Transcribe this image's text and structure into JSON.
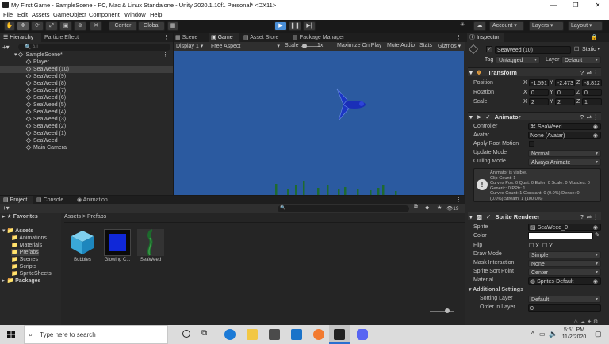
{
  "window": {
    "title": "My First Game - SampleScene - PC, Mac & Linux Standalone - Unity 2020.1.10f1 Personal* <DX11>",
    "min": "—",
    "max": "❐",
    "close": "✕"
  },
  "menu": [
    "File",
    "Edit",
    "Assets",
    "GameObject",
    "Component",
    "Window",
    "Help"
  ],
  "toolbar": {
    "center": "Center",
    "global": "Global",
    "account": "Account",
    "layers": "Layers",
    "layout": "Layout"
  },
  "hierarchy": {
    "tabs": [
      "Hierarchy",
      "Particle Effect"
    ],
    "search_placeholder": "All",
    "scene": "SampleScene*",
    "items": [
      "Player",
      "SeaWeed (10)",
      "SeaWeed (9)",
      "SeaWeed (8)",
      "SeaWeed (7)",
      "SeaWeed (6)",
      "SeaWeed (5)",
      "SeaWeed (4)",
      "SeaWeed (3)",
      "SeaWeed (2)",
      "SeaWeed (1)",
      "SeaWeed",
      "Main Camera"
    ],
    "selected_index": 1
  },
  "game": {
    "tabs": [
      "Scene",
      "Game",
      "Asset Store",
      "Package Manager"
    ],
    "display": "Display 1",
    "aspect": "Free Aspect",
    "scale_label": "Scale",
    "scale_value": "1x",
    "opts": [
      "Maximize On Play",
      "Mute Audio",
      "Stats",
      "Gizmos"
    ],
    "bg": "#2b5aa0"
  },
  "project": {
    "tabs": [
      "Project",
      "Console",
      "Animation"
    ],
    "favorites": "Favorites",
    "assets": "Assets",
    "folders": [
      "Animations",
      "Materials",
      "Prefabs",
      "Scenes",
      "Scripts",
      "SpriteSheets"
    ],
    "packages": "Packages",
    "breadcrumb_root": "Assets",
    "breadcrumb_sep": ">",
    "breadcrumb_leaf": "Prefabs",
    "count": "19",
    "items": [
      "Bubbles",
      "Glowing C...",
      "SeaWeed"
    ]
  },
  "inspector": {
    "tab": "Inspector",
    "name": "SeaWeed (10)",
    "static": "Static",
    "tag_label": "Tag",
    "tag": "Untagged",
    "layer_label": "Layer",
    "layer": "Default",
    "transform": {
      "title": "Transform",
      "position": "Position",
      "rotation": "Rotation",
      "scale": "Scale",
      "px": "-1.591",
      "py": "-2.473",
      "pz": "-8.812",
      "rx": "0",
      "ry": "0",
      "rz": "0",
      "sx": "2",
      "sy": "2",
      "sz": "1",
      "X": "X",
      "Y": "Y",
      "Z": "Z"
    },
    "animator": {
      "title": "Animator",
      "controller_label": "Controller",
      "controller": "SeaWeed",
      "avatar_label": "Avatar",
      "avatar": "None (Avatar)",
      "root_label": "Apply Root Motion",
      "update_label": "Update Mode",
      "update": "Normal",
      "culling_label": "Culling Mode",
      "culling": "Always Animate",
      "info": [
        "Animator is visible.",
        "Clip Count: 1",
        "Curves Pos: 0 Quat: 0 Euler: 0 Scale: 0 Muscles: 0",
        "Generic: 0 PPtr: 1",
        "Curves Count: 1 Constant: 0 (0.0%) Dense: 0",
        "(0.0%) Stream: 1 (100.0%)"
      ]
    },
    "sprite": {
      "title": "Sprite Renderer",
      "sprite_label": "Sprite",
      "sprite": "SeaWeed_0",
      "color_label": "Color",
      "flip_label": "Flip",
      "flipx": "X",
      "flipy": "Y",
      "draw_label": "Draw Mode",
      "draw": "Simple",
      "mask_label": "Mask Interaction",
      "mask": "None",
      "sort_label": "Sprite Sort Point",
      "sort": "Center",
      "material_label": "Material",
      "material": "Sprites-Default",
      "additional": "Additional Settings",
      "sortlayer_label": "Sorting Layer",
      "sortlayer": "Default",
      "order_label": "Order in Layer",
      "order": "0"
    }
  },
  "taskbar": {
    "search": "Type here to search",
    "time": "5:51 PM",
    "date": "11/2/2020"
  }
}
